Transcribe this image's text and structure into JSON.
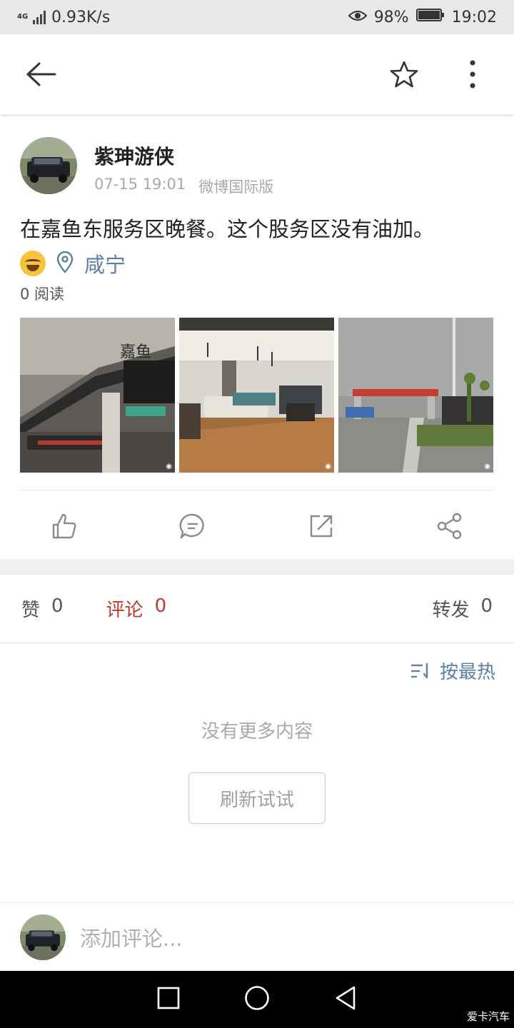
{
  "status_bar": {
    "network": "4G",
    "speed": "0.93K/s",
    "battery": "98%",
    "time": "19:02"
  },
  "app_bar": {
    "back_icon": "arrow-left-icon",
    "favorite_icon": "star-outline-icon",
    "more_icon": "more-vertical-icon"
  },
  "post": {
    "author": "紫珅游侠",
    "time": "07-15 19:01",
    "source": "微博国际版",
    "text": "在嘉鱼东服务区晚餐。这个股务区没有油加。",
    "location": "咸宁",
    "reads": "0 阅读",
    "photos": [
      {
        "icon": "weibo-watermark-icon"
      },
      {
        "icon": "weibo-watermark-icon"
      },
      {
        "icon": "weibo-watermark-icon"
      }
    ],
    "actions": [
      {
        "name": "like",
        "icon": "thumbs-up-icon"
      },
      {
        "name": "comment",
        "icon": "comment-bubble-icon"
      },
      {
        "name": "repost",
        "icon": "share-box-icon"
      },
      {
        "name": "share",
        "icon": "share-nodes-icon"
      }
    ]
  },
  "stats": {
    "likes_label": "赞",
    "likes_count": "0",
    "comments_label": "评论",
    "comments_count": "0",
    "reposts_label": "转发",
    "reposts_count": "0"
  },
  "sort": {
    "label": "按最热",
    "icon": "sort-icon"
  },
  "empty_text": "没有更多内容",
  "refresh_label": "刷新试试",
  "comment_input": {
    "placeholder": "添加评论..."
  },
  "watermark": "爱卡汽车",
  "colors": {
    "accent_blue": "#5b7fa6",
    "accent_red": "#c0392b",
    "muted_gray": "#a9a9a9"
  }
}
